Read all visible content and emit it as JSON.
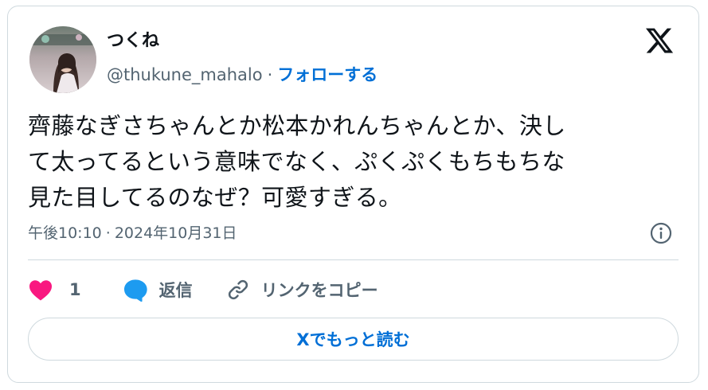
{
  "author": {
    "display_name": "つくね",
    "handle": "@thukune_mahalo",
    "separator": "·",
    "follow_label": "フォローする",
    "avatar": "profile-photo"
  },
  "tweet": {
    "lines": [
      "齊藤なぎさちゃんとか松本かれんちゃんとか、決し",
      "て太ってるという意味でなく、ぷくぷくもちもちな",
      "見た目してるのなぜ？可愛すぎる。"
    ]
  },
  "meta": {
    "time": "午後10:10",
    "separator": "·",
    "date": "2024年10月31日"
  },
  "actions": {
    "like_count": "1",
    "reply_label": "返信",
    "copy_link_label": "リンクをコピー"
  },
  "read_more_label": "Xでもっと読む",
  "icons": {
    "brand": "x-logo-icon",
    "info": "info-icon",
    "like": "heart-icon",
    "reply": "reply-bubble-icon",
    "link": "link-icon"
  },
  "colors": {
    "link_blue": "#006fd6",
    "heart_pink": "#f91880",
    "reply_blue": "#1d9bf0",
    "muted_text": "#536471",
    "border": "#cfd9de"
  }
}
